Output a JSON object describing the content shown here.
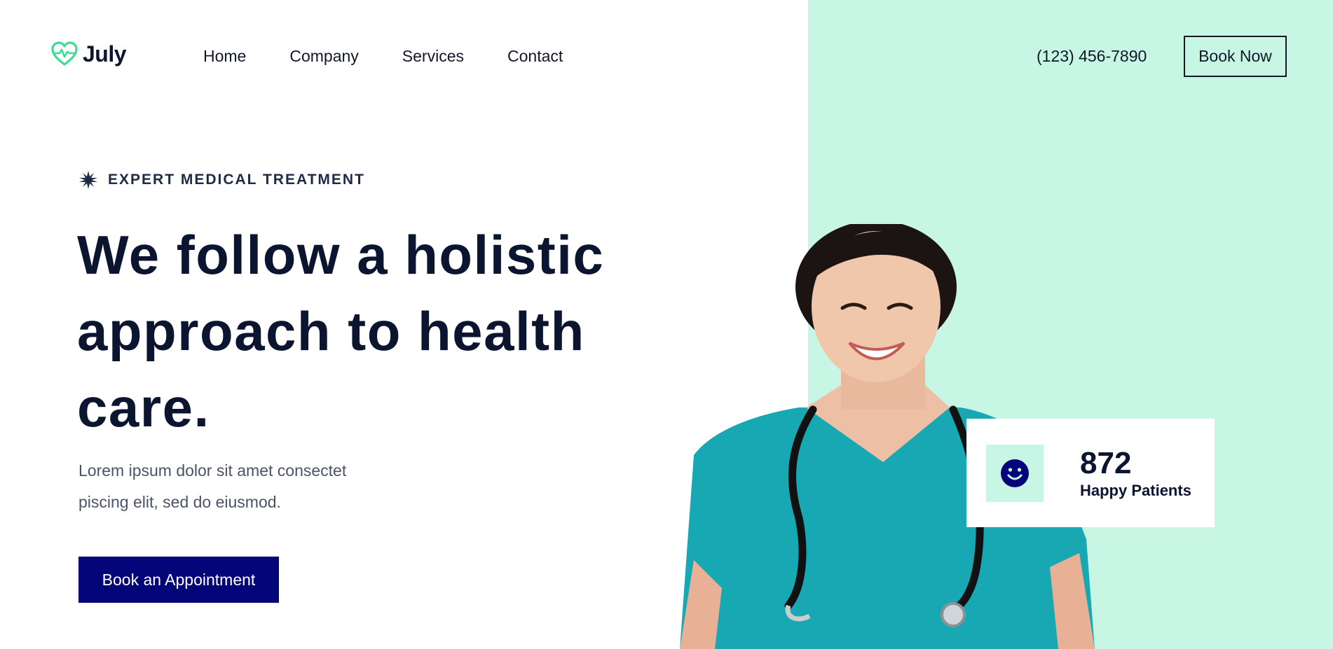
{
  "brand": {
    "name": "July",
    "accent": "#3ddc97"
  },
  "nav": {
    "items": [
      "Home",
      "Company",
      "Services",
      "Contact"
    ]
  },
  "header": {
    "phone": "(123) 456-7890",
    "book_now_label": "Book Now"
  },
  "hero": {
    "eyebrow": "EXPERT MEDICAL TREATMENT",
    "headline": "We follow a holistic approach to health care.",
    "lead": "Lorem ipsum dolor sit amet consectet piscing elit, sed do eiusmod.",
    "cta_label": "Book an Appointment"
  },
  "stat": {
    "value": "872",
    "label": "Happy Patients",
    "icon": "smile-icon"
  },
  "colors": {
    "mint": "#c7f7e4",
    "navy": "#05057a",
    "scrubs": "#17a8b4",
    "text": "#0b1530"
  }
}
